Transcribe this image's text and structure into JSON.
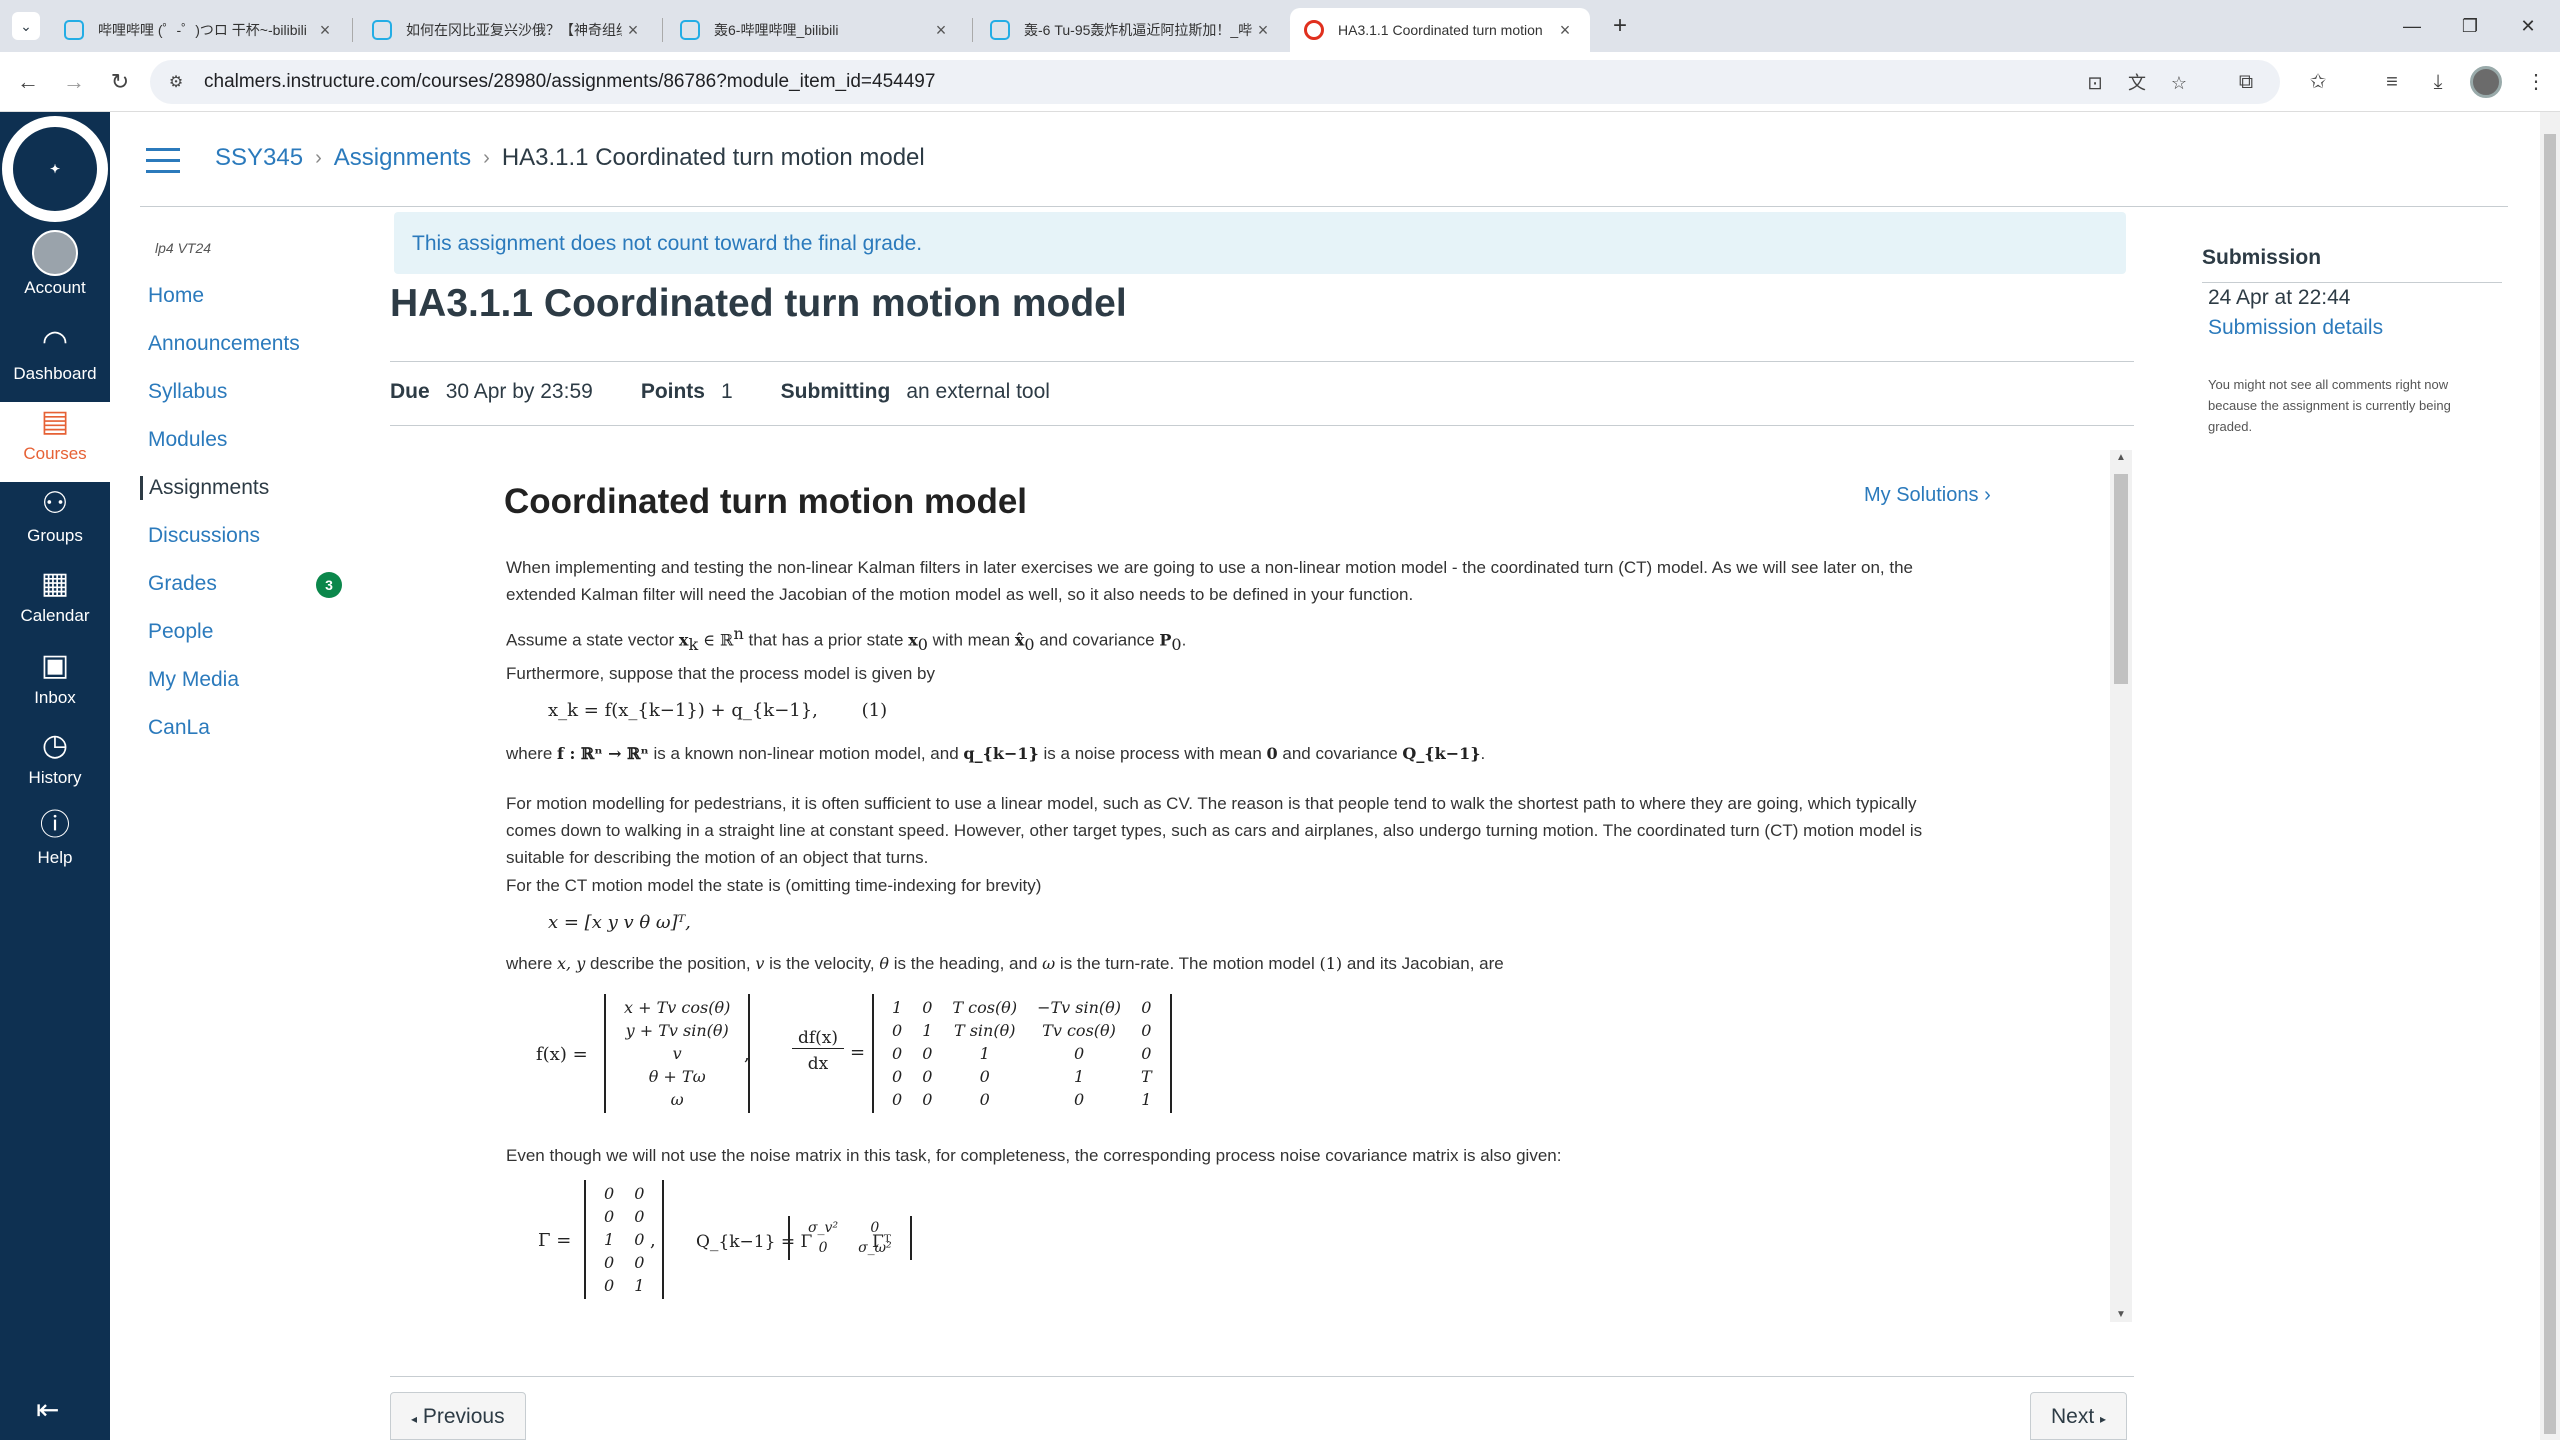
{
  "browser": {
    "tabs": [
      {
        "label": "哔哩哔哩 (゜-゜)つロ 干杯~-bilibili"
      },
      {
        "label": "如何在冈比亚复兴沙俄？【神奇组织"
      },
      {
        "label": "轰6-哔哩哔哩_bilibili"
      },
      {
        "label": "轰-6 Tu-95轰炸机逼近阿拉斯加！_哔"
      },
      {
        "label": "HA3.1.1 Coordinated turn motion"
      }
    ],
    "url": "chalmers.instructure.com/courses/28980/assignments/86786?module_item_id=454497",
    "icons": [
      "menu-icon",
      "close-icon",
      "plus-icon",
      "minimize-icon",
      "restore-icon",
      "back-icon",
      "forward-icon",
      "reload-icon",
      "site-settings-icon",
      "install-icon",
      "translate-icon",
      "star-icon",
      "extensions-icon",
      "bookmark-icon",
      "media-icon",
      "download-icon"
    ]
  },
  "global_nav": {
    "items": [
      {
        "label": "Account"
      },
      {
        "label": "Dashboard"
      },
      {
        "label": "Courses"
      },
      {
        "label": "Groups"
      },
      {
        "label": "Calendar"
      },
      {
        "label": "Inbox"
      },
      {
        "label": "History"
      },
      {
        "label": "Help"
      }
    ],
    "active_color": "#e66135",
    "bg_color": "#0e3051"
  },
  "breadcrumb": {
    "course": "SSY345",
    "section": "Assignments",
    "current": "HA3.1.1 Coordinated turn motion model"
  },
  "course_nav": {
    "term": "lp4 VT24",
    "items": [
      {
        "label": "Home"
      },
      {
        "label": "Announcements"
      },
      {
        "label": "Syllabus"
      },
      {
        "label": "Modules"
      },
      {
        "label": "Assignments"
      },
      {
        "label": "Discussions"
      },
      {
        "label": "Grades"
      },
      {
        "label": "People"
      },
      {
        "label": "My Media"
      },
      {
        "label": "CanLa"
      }
    ],
    "grades_badge": "3"
  },
  "assignment": {
    "alert": "This assignment does not count toward the final grade.",
    "title": "HA3.1.1 Coordinated turn motion model",
    "due_label": "Due",
    "due_value": "30 Apr by 23:59",
    "points_label": "Points",
    "points_value": "1",
    "submitting_label": "Submitting",
    "submitting_value": "an external tool"
  },
  "content": {
    "title": "Coordinated turn motion model",
    "my_solutions": "My Solutions",
    "p1": "When implementing and testing the non-linear Kalman filters in later exercises we are going to use a non-linear motion model - the coordinated turn (CT) model. As we will see later on, the extended Kalman filter will need the Jacobian of the motion model as well, so it also needs to be defined in your function.",
    "p2_a": "Assume a state vector ",
    "p2_m1": "x",
    "p2_m1_sub": "k",
    "p2_m2": " ∈ ℝ",
    "p2_m2_sup": "n",
    "p2_b": " that has a prior state ",
    "p2_m3": "x",
    "p2_m3_sub": "0",
    "p2_c": " with mean ",
    "p2_m4": "x̂",
    "p2_m4_sub": "0",
    "p2_d": " and covariance ",
    "p2_m5": "P",
    "p2_m5_sub": "0",
    "p2_e": ".",
    "p3": "Furthermore, suppose that the process model is given by",
    "eq1": "x_k = f(x_{k−1}) + q_{k−1},",
    "eq1_num": "(1)",
    "p4_a": "where ",
    "p4_m1": "f : ℝⁿ → ℝⁿ",
    "p4_b": " is a known non-linear motion model, and ",
    "p4_m2": "q_{k−1}",
    "p4_c": " is a noise process with mean ",
    "p4_m3": "0",
    "p4_d": " and covariance ",
    "p4_m4": "Q_{k−1}",
    "p4_e": ".",
    "p5": "For motion modelling for pedestrians, it is often sufficient to use a linear model, such as CV. The reason is that people tend to walk the shortest path to where they are going, which typically comes down to walking in a straight line at constant speed. However, other target types, such as cars and airplanes, also undergo turning motion. The coordinated turn (CT) motion model is suitable for describing the motion of an object that turns.",
    "p6": "For the CT motion model the state is (omitting time-indexing for brevity)",
    "eq2": "x = [x   y   v   θ   ω]ᵀ,",
    "p7_a": "where ",
    "p7_m1": "x,  y",
    "p7_b": " describe the position, ",
    "p7_m2": "v",
    "p7_c": " is the velocity, ",
    "p7_m3": "θ",
    "p7_d": " is the heading, and ",
    "p7_m4": "ω",
    "p7_e": " is the turn-rate. The motion model ",
    "p7_m5": "(1)",
    "p7_f": " and its Jacobian, are",
    "f_label": "f(x) =",
    "f_vec": [
      "x + Tv cos(θ)",
      "y + Tv sin(θ)",
      "v",
      "θ + Tω",
      "ω"
    ],
    "jac_num": "df(x)",
    "jac_den": "dx",
    "jac": [
      [
        "1",
        "0",
        "T cos(θ)",
        "−Tv sin(θ)",
        "0"
      ],
      [
        "0",
        "1",
        "T sin(θ)",
        "Tv cos(θ)",
        "0"
      ],
      [
        "0",
        "0",
        "1",
        "0",
        "0"
      ],
      [
        "0",
        "0",
        "0",
        "1",
        "T"
      ],
      [
        "0",
        "0",
        "0",
        "0",
        "1"
      ]
    ],
    "p8": "Even though we will not use the noise matrix in this task, for completeness, the corresponding process noise covariance matrix is also given:",
    "gamma_label": "Γ =",
    "gamma": [
      [
        "0",
        "0"
      ],
      [
        "0",
        "0"
      ],
      [
        "1",
        "0"
      ],
      [
        "0",
        "0"
      ],
      [
        "0",
        "1"
      ]
    ],
    "q_label": "Q_{k−1} = Γ",
    "q_mat": [
      [
        "σ_v²",
        "0"
      ],
      [
        "0",
        "σ_ω²"
      ]
    ],
    "q_tail": "Γᵀ"
  },
  "pager": {
    "previous": "Previous",
    "next": "Next"
  },
  "submission": {
    "title": "Submission",
    "date": "24 Apr at 22:44",
    "details": "Submission details",
    "note": "You might not see all comments right now because the assignment is currently being graded."
  }
}
